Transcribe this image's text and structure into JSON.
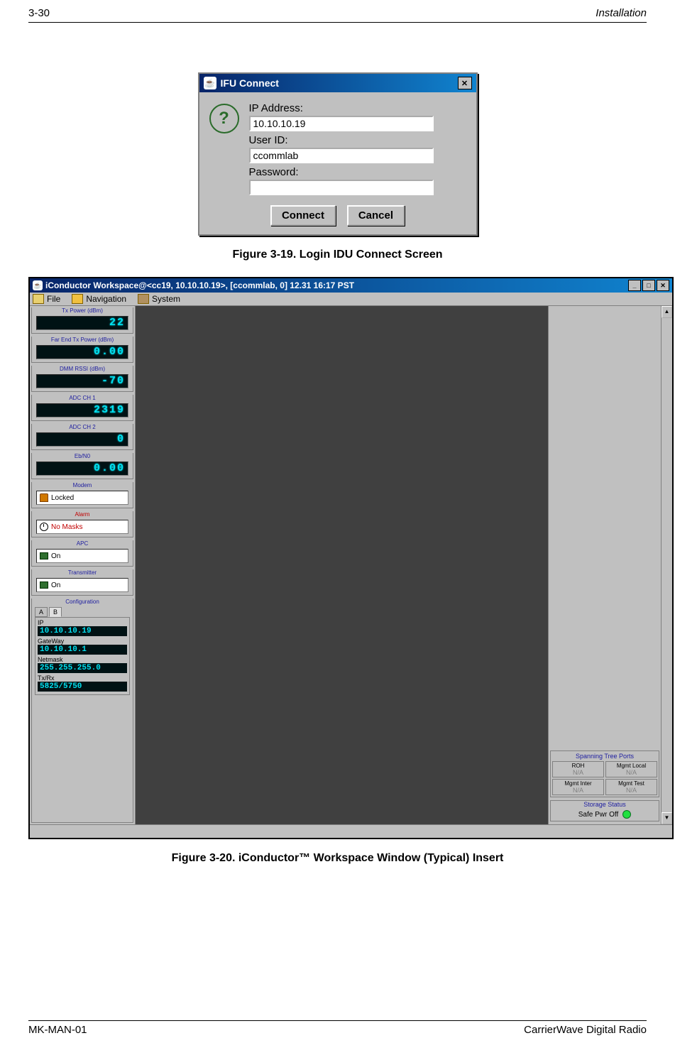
{
  "header": {
    "page": "3-30",
    "section": "Installation"
  },
  "footer": {
    "doc": "MK-MAN-01",
    "product": "CarrierWave Digital Radio"
  },
  "dialog": {
    "title": "IFU Connect",
    "ip_label": "IP Address:",
    "ip_value": "10.10.10.19",
    "user_label": "User ID:",
    "user_value": "ccommlab",
    "pass_label": "Password:",
    "pass_value": "",
    "connect": "Connect",
    "cancel": "Cancel"
  },
  "fig319": "Figure 3-19.   Login IDU Connect Screen",
  "ws": {
    "title": "iConductor Workspace@<cc19, 10.10.10.19>, [ccommlab, 0] 12.31 16:17 PST",
    "menu": {
      "file": "File",
      "nav": "Navigation",
      "sys": "System"
    },
    "sidebar": {
      "txpower": {
        "label": "Tx Power (dBm)",
        "value": "22"
      },
      "farend": {
        "label": "Far End Tx Power (dBm)",
        "value": "0.00"
      },
      "dmm": {
        "label": "DMM RSSI (dBm)",
        "value": "-70"
      },
      "adc1": {
        "label": "ADC CH 1",
        "value": "2319"
      },
      "adc2": {
        "label": "ADC CH 2",
        "value": "0"
      },
      "ebn0": {
        "label": "Eb/N0",
        "value": "0.00"
      },
      "modem": {
        "label": "Modem",
        "value": "Locked"
      },
      "alarm": {
        "label": "Alarm",
        "value": "No Masks"
      },
      "apc": {
        "label": "APC",
        "value": "On"
      },
      "tx": {
        "label": "Transmitter",
        "value": "On"
      },
      "cfg": {
        "label": "Configuration",
        "tabA": "A",
        "tabB": "B",
        "ip_l": "IP",
        "ip_v": "10.10.10.19",
        "gw_l": "GateWay",
        "gw_v": "10.10.10.1",
        "nm_l": "Netmask",
        "nm_v": "255.255.255.0",
        "tr_l": "Tx/Rx",
        "tr_v": "5825/5750"
      }
    },
    "right": {
      "stp_title": "Spanning Tree Ports",
      "cells": {
        "roh": "ROH",
        "mgmt_local": "Mgmt Local",
        "mgmt_inter": "Mgmt Inter",
        "mgmt_test": "Mgmt Test",
        "na": "N/A"
      },
      "storage_title": "Storage Status",
      "safe": "Safe Pwr Off"
    }
  },
  "fig320": "Figure 3-20.   iConductor™ Workspace Window (Typical) Insert"
}
